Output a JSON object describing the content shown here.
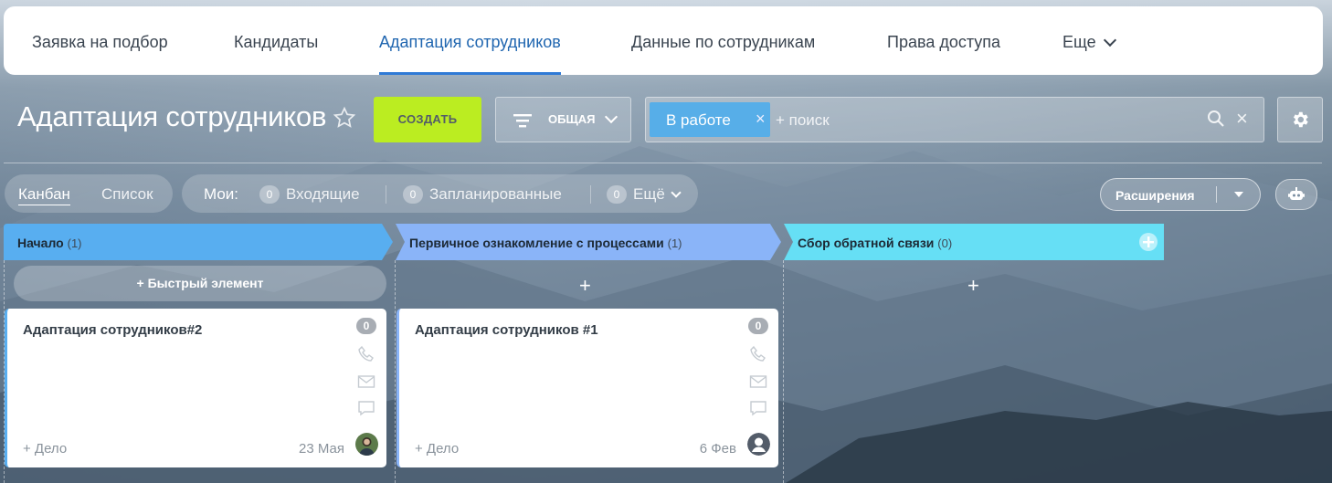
{
  "topnav": {
    "tabs": [
      {
        "label": "Заявка на подбор"
      },
      {
        "label": "Кандидаты"
      },
      {
        "label": "Адаптация сотрудников",
        "active": true
      },
      {
        "label": "Данные по сотрудникам"
      },
      {
        "label": "Права доступа"
      },
      {
        "label": "Еще"
      }
    ]
  },
  "page": {
    "title": "Адаптация сотрудников",
    "create_label": "СОЗДАТЬ",
    "filter_label": "ОБЩАЯ",
    "search": {
      "chip": "В работе",
      "placeholder": "+ поиск"
    }
  },
  "views": {
    "kanban": "Канбан",
    "list": "Список"
  },
  "counters": {
    "label": "Мои:",
    "items": [
      {
        "count": "0",
        "label": "Входящие"
      },
      {
        "count": "0",
        "label": "Запланированные"
      },
      {
        "count": "0",
        "label": "Ещё"
      }
    ]
  },
  "extensions_label": "Расширения",
  "columns": [
    {
      "title": "Начало",
      "count": "(1)",
      "color": "#58aef0"
    },
    {
      "title": "Первичное ознакомление с процессами",
      "count": "(1)",
      "color": "#8ab4f8"
    },
    {
      "title": "Сбор обратной связи",
      "count": "(0)",
      "color": "#66dff5"
    }
  ],
  "quick_add_label": "+ Быстрый элемент",
  "add_plus": "+",
  "cards": [
    {
      "title": "Адаптация сотрудников#2",
      "badge": "0",
      "add_todo": "+ Дело",
      "date": "23 Мая"
    },
    {
      "title": "Адаптация сотрудников #1",
      "badge": "0",
      "add_todo": "+ Дело",
      "date": "6 Фев"
    }
  ],
  "colors": {
    "accent": "#2f7ad6",
    "create": "#bbed21",
    "chip": "#57aee8"
  }
}
